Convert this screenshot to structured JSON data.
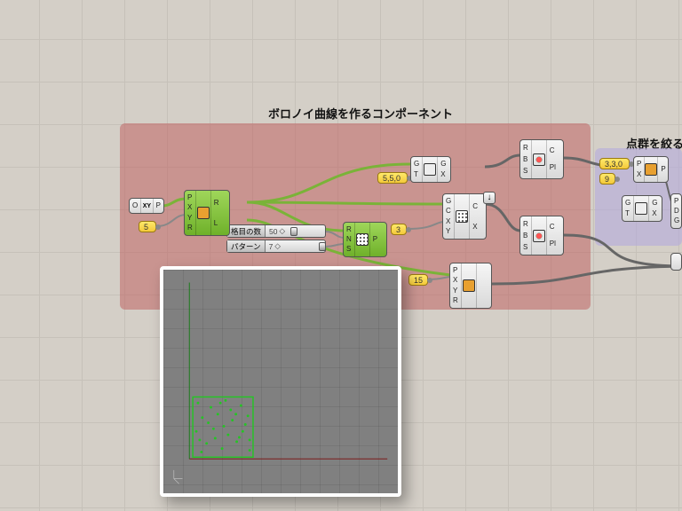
{
  "titles": {
    "red": "ボロノイ曲線を作るコンポーネント",
    "purple": "点群を絞る"
  },
  "panels": {
    "p5": "5",
    "p550": "5,5,0",
    "p3": "3",
    "p15": "15",
    "p330": "3,3,0",
    "p9": "9"
  },
  "sliders": {
    "s1": {
      "label": "格目の数",
      "value": "50",
      "knob_pct": 42
    },
    "s2": {
      "label": "パターン",
      "value": "7",
      "knob_pct": 92
    }
  },
  "comp_xy": {
    "in": [
      "O"
    ],
    "out": [
      "P"
    ],
    "mid_label": "XY"
  },
  "comp_rect": {
    "in": [
      "P",
      "X",
      "Y",
      "R"
    ],
    "out": [
      "R",
      "L"
    ]
  },
  "comp_pop": {
    "in": [
      "R",
      "N",
      "S"
    ],
    "out": [
      "P"
    ]
  },
  "comp_gx1": {
    "in": [
      "G",
      "T"
    ],
    "out": [
      "G",
      "X"
    ]
  },
  "comp_vor": {
    "in": [
      "G",
      "C",
      "X",
      "Y"
    ],
    "out": [
      "C",
      "X"
    ]
  },
  "comp_orient1": {
    "in": [
      "R",
      "B",
      "S"
    ],
    "out": [
      "C",
      "Pl"
    ]
  },
  "comp_orient2": {
    "in": [
      "R",
      "B",
      "S"
    ],
    "out": [
      "C",
      "Pl"
    ]
  },
  "comp_box": {
    "in": [
      "P",
      "X",
      "Y",
      "R"
    ],
    "out": []
  },
  "comp_pt1": {
    "in": [
      "P",
      "X"
    ],
    "out": [
      "P"
    ]
  },
  "comp_gx2": {
    "in": [
      "G",
      "T"
    ],
    "out": [
      "G",
      "X"
    ]
  },
  "comp_sel": {
    "in": [
      "P",
      "D",
      "G"
    ],
    "out": []
  }
}
